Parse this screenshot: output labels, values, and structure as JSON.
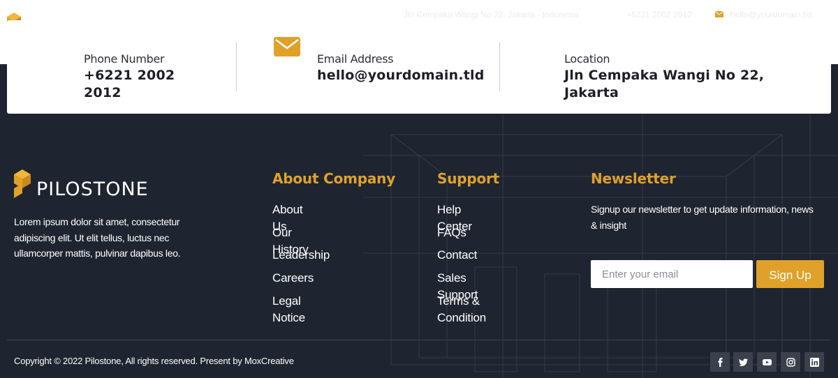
{
  "topbar": {
    "address": "Jln Cempaka Wangi No 22, Jakarta - Indonesia",
    "phone": "+6221 2002 2012",
    "email": "hello@yourdomain.tld"
  },
  "contact": {
    "phone_label": "Phone Number",
    "phone_line1": "+6221 2002",
    "phone_line2": "2012",
    "email_label": "Email Address",
    "email_value": "hello@yourdomain.tld",
    "location_label": "Location",
    "location_line1": "Jln Cempaka Wangi No 22,",
    "location_line2": "Jakarta"
  },
  "brand": {
    "name": "PILOSTONE",
    "description": "Lorem ipsum dolor sit amet, consectetur adipiscing elit. Ut elit tellus, luctus nec ullamcorper mattis, pulvinar dapibus leo."
  },
  "about": {
    "title": "About Company",
    "links": [
      "About Us",
      "Our History",
      "Leadership",
      "Careers",
      "Legal Notice"
    ]
  },
  "support": {
    "title": "Support",
    "links": [
      "Help Center",
      "FAQs",
      "Contact",
      "Sales Support",
      "Terms & Condition"
    ]
  },
  "newsletter": {
    "title": "Newsletter",
    "description": "Signup our newsletter to get update information, news & insight",
    "placeholder": "Enter your email",
    "button": "Sign Up"
  },
  "footer": {
    "copyright": "Copyright © 2022 Pilostone, All rights reserved. Present by MoxCreative",
    "social": [
      "facebook-icon",
      "twitter-icon",
      "youtube-icon",
      "instagram-icon",
      "linkedin-icon"
    ]
  },
  "colors": {
    "accent": "#e0a12a",
    "dark_bg": "#1e2530",
    "white": "#ffffff"
  }
}
